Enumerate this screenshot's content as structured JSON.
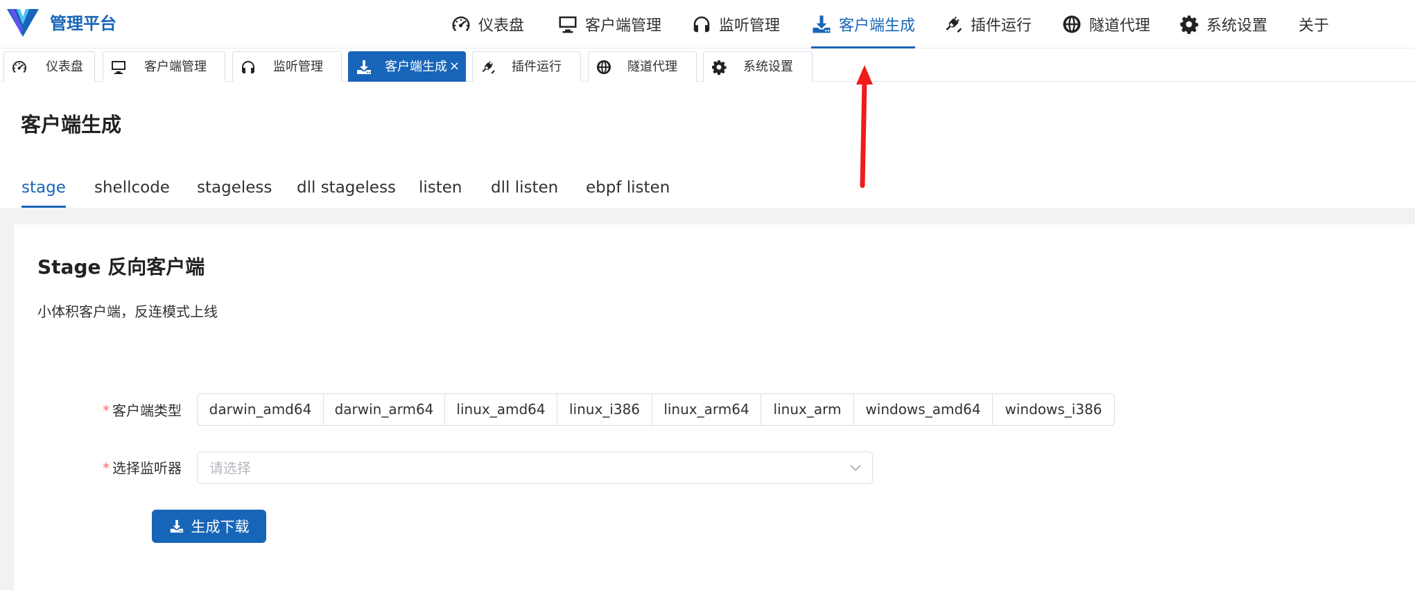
{
  "app": {
    "brand": "管理平台",
    "accent_color": "#1765b8"
  },
  "nav": {
    "items": [
      {
        "label": "仪表盘",
        "icon": "dashboard-icon"
      },
      {
        "label": "客户端管理",
        "icon": "monitor-icon"
      },
      {
        "label": "监听管理",
        "icon": "headphones-icon"
      },
      {
        "label": "客户端生成",
        "icon": "download-icon",
        "active": true
      },
      {
        "label": "插件运行",
        "icon": "plug-icon"
      },
      {
        "label": "隧道代理",
        "icon": "globe-icon"
      },
      {
        "label": "系统设置",
        "icon": "gear-icon"
      },
      {
        "label": "关于"
      }
    ]
  },
  "tabs": {
    "items": [
      {
        "label": "仪表盘",
        "icon": "dashboard-icon"
      },
      {
        "label": "客户端管理",
        "icon": "monitor-icon"
      },
      {
        "label": "监听管理",
        "icon": "headphones-icon"
      },
      {
        "label": "客户端生成",
        "icon": "download-icon",
        "active": true,
        "close": "×"
      },
      {
        "label": "插件运行",
        "icon": "plug-icon"
      },
      {
        "label": "隧道代理",
        "icon": "globe-icon"
      },
      {
        "label": "系统设置",
        "icon": "gear-icon"
      }
    ]
  },
  "page": {
    "title": "客户端生成",
    "subtabs": [
      "stage",
      "shellcode",
      "stageless",
      "dll stageless",
      "listen",
      "dll listen",
      "ebpf listen"
    ],
    "active_subtab": "stage"
  },
  "card": {
    "title": "Stage 反向客户端",
    "description": "小体积客户端，反连模式上线"
  },
  "form": {
    "required_mark": "*",
    "client_type_label": "客户端类型",
    "client_types": [
      "darwin_amd64",
      "darwin_arm64",
      "linux_amd64",
      "linux_i386",
      "linux_arm64",
      "linux_arm",
      "windows_amd64",
      "windows_i386"
    ],
    "listener_label": "选择监听器",
    "listener_placeholder": "请选择",
    "submit_label": "生成下载"
  },
  "annotation": {
    "arrow_color": "#ee1c1c"
  }
}
